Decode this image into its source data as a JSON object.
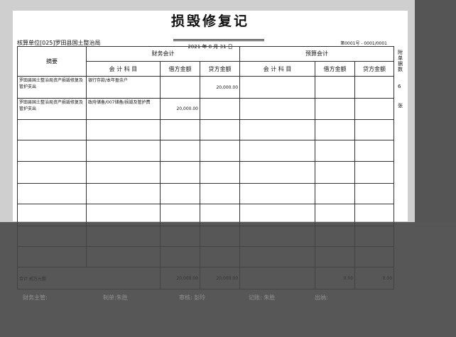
{
  "document": {
    "title": "损毁修复记",
    "date": "2021 年 8 月 31 日",
    "unit": "核算单位[025]罗田县国土整治局",
    "voucher_no": "第0001号 - 0001/0001",
    "columns": {
      "summary": "摘要",
      "financial": "财务会计",
      "budget": "预算会计",
      "fin_subject": "会 计 科 目",
      "fin_debit": "借方金额",
      "fin_credit": "贷方金额",
      "bud_subject": "会 计 科 目",
      "bud_debit": "借方金额",
      "bud_credit": "贷方金额"
    },
    "rows": [
      {
        "summary": "罗田县国土整治局资产损毁修复及管护支出",
        "fin_subject": "银行存款/本年盈余户",
        "fin_debit": "",
        "fin_credit": "20,000.00"
      },
      {
        "summary": "罗田县国土整治局资产损毁修复及管护支出",
        "fin_subject": "政府储备/007储备/损毁及管护费",
        "fin_debit": "20,000.00",
        "fin_credit": ""
      }
    ],
    "total": {
      "label": "合计 贰万元整",
      "fin_debit": "20,000.00",
      "fin_credit": "20,000.00",
      "bud_debit": "0.00",
      "bud_credit": "0.00"
    },
    "side_attachments": "附单据数",
    "side_count": "6",
    "side_unit": "张",
    "footer": {
      "supervisor": "财务主管:",
      "maker": "制单:朱胜",
      "reviewer": "审核: 彭玲",
      "bookkeeper": "记账: 朱胜",
      "cashier": "出纳:"
    }
  }
}
